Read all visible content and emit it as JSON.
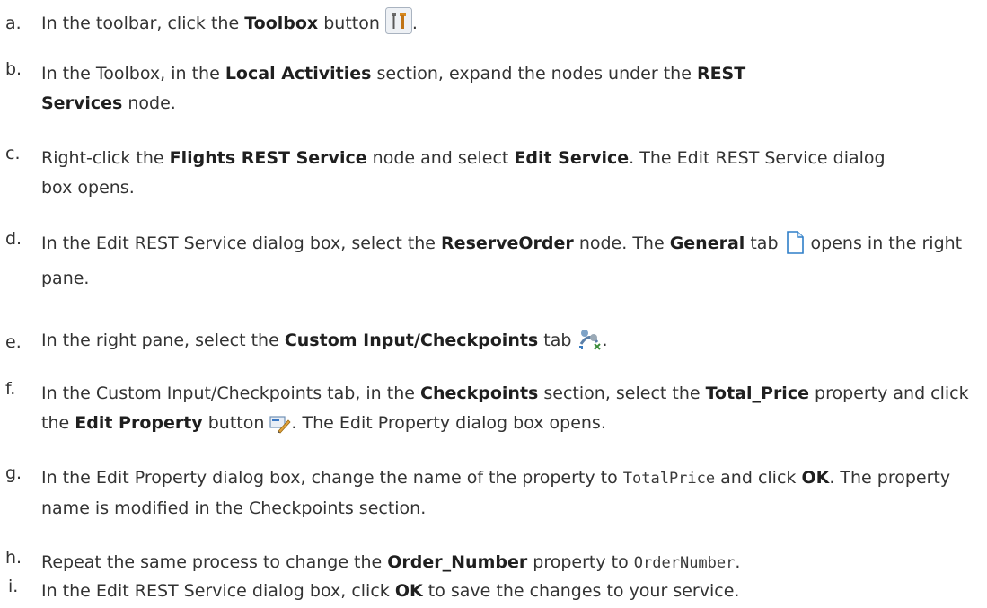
{
  "steps": [
    {
      "letter": "a.",
      "p1": "In the toolbar, click the ",
      "b1": "Toolbox",
      "p2": " button",
      "p3": "."
    },
    {
      "letter": "b.",
      "p1": "In the Toolbox, in the ",
      "b1": "Local Activities",
      "p2": " section, expand the nodes under the ",
      "b2": "REST Services",
      "p3": " node."
    },
    {
      "letter": "c.",
      "p1": "Right-click the ",
      "b1": "Flights REST Service",
      "p2": " node and select ",
      "b2": "Edit Service",
      "p3": ". The Edit REST Service dialog box opens."
    },
    {
      "letter": "d.",
      "p1": "In the Edit REST Service dialog box, select the ",
      "b1": "ReserveOrder",
      "p2": " node. The ",
      "b2": "General",
      "p3": " tab",
      "p4": " opens in the right pane."
    },
    {
      "letter": "e.",
      "p1": "In the right pane, select the ",
      "b1": "Custom Input/Checkpoints",
      "p2": " tab",
      "p3": "."
    },
    {
      "letter": "f.",
      "p1": "In the Custom Input/Checkpoints tab, in the ",
      "b1": "Checkpoints",
      "p2": " section, select the ",
      "b2": "Total_Price",
      "p3": " property and click the ",
      "b3": "Edit Property",
      "p4": " button",
      "p5": ". The Edit Property dialog box opens."
    },
    {
      "letter": "g.",
      "p1": "In the Edit Property dialog box, change the name of the property to ",
      "c1": "TotalPrice",
      "p2": " and click ",
      "b1": "OK",
      "p3": ". The property name is modified in the Checkpoints section."
    },
    {
      "letter": "h.",
      "p1": "Repeat the same process to change the ",
      "b1": "Order_Number",
      "p2": " property to ",
      "c1": "OrderNumber",
      "p3": "."
    },
    {
      "letter": "i.",
      "p1": "In the Edit REST Service dialog box, click ",
      "b1": "OK",
      "p2": " to save the changes to your service."
    }
  ],
  "icons": {
    "toolbox": "toolbox-icon",
    "general_tab": "document-icon",
    "custom_input_tab": "checkpoint-icon",
    "edit_property": "edit-property-icon"
  }
}
